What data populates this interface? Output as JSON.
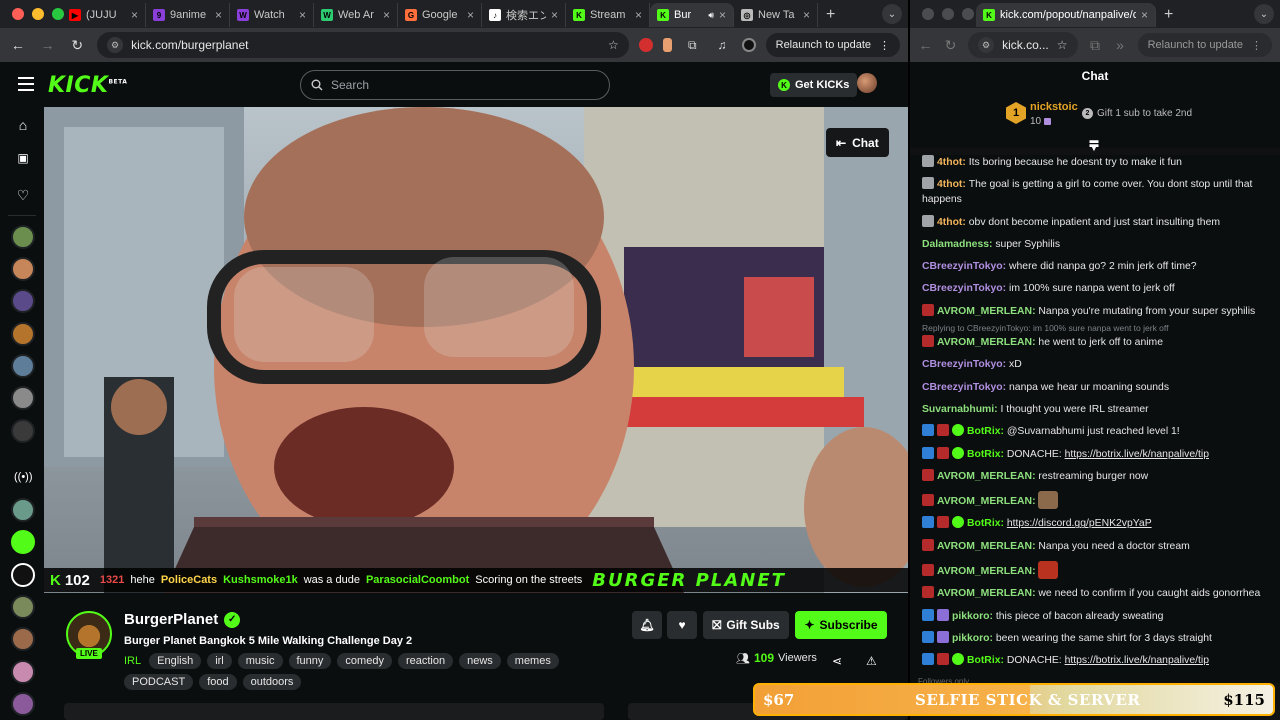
{
  "left_window": {
    "tabs": [
      {
        "title": "(JUJU",
        "fav_color": "#ff0000",
        "fav": "▶"
      },
      {
        "title": "9anime",
        "fav_color": "#8b3fd9",
        "fav": "9"
      },
      {
        "title": "Watch",
        "fav_color": "#8b3fd9",
        "fav": "W"
      },
      {
        "title": "Web Ar",
        "fav_color": "#2ecc71",
        "fav": "W"
      },
      {
        "title": "Google",
        "fav_color": "#ff6f3c",
        "fav": "G"
      },
      {
        "title": "検索エン",
        "fav_color": "#ffffff",
        "fav": "♪"
      },
      {
        "title": "Stream",
        "fav_color": "#53fc18",
        "fav": "K"
      },
      {
        "title": "Bur",
        "fav_color": "#53fc18",
        "fav": "K",
        "active": true
      },
      {
        "title": "New Ta",
        "fav_color": "#bbbbbb",
        "fav": "◎"
      }
    ],
    "url": "kick.com/burgerplanet",
    "relaunch": "Relaunch to update"
  },
  "right_window": {
    "url": "kick.com/popout/nanpalive/ch",
    "url_short": "kick.co...",
    "relaunch": "Relaunch to update"
  },
  "kick": {
    "search_placeholder": "Search",
    "get_kicks": "Get KICKs",
    "chat_button": "Chat",
    "ticker": {
      "count": "102",
      "items": [
        {
          "text": "1321",
          "cls": "red"
        },
        {
          "text": "hehe",
          "cls": ""
        },
        {
          "text": "PoliceCats",
          "cls": "yel"
        },
        {
          "text": "Kushsmoke1k",
          "cls": "grn"
        },
        {
          "text": "was a dude",
          "cls": ""
        },
        {
          "text": "ParasocialCoombot",
          "cls": "grn"
        },
        {
          "text": "Scoring on the streets",
          "cls": ""
        }
      ],
      "banner": "BURGER PLANET"
    },
    "streamer": {
      "name": "BurgerPlanet",
      "live": "LIVE",
      "title": "Burger Planet Bangkok 5 Mile Walking Challenge Day 2",
      "category": "IRL",
      "tags": [
        "English",
        "irl",
        "music",
        "funny",
        "comedy",
        "reaction",
        "news",
        "memes",
        "PODCAST",
        "food",
        "outdoors"
      ],
      "viewers_count": "109",
      "viewers_label": "Viewers",
      "gift_subs": "Gift Subs",
      "subscribe": "Subscribe"
    }
  },
  "chat": {
    "header": "Chat",
    "pinned": {
      "rank": "1",
      "name": "nickstoic",
      "count": "10",
      "gift_text": "Gift 1 sub to take 2nd"
    },
    "messages": [
      {
        "user": "4thot",
        "color": "#f0b35b",
        "badges": [
          "av"
        ],
        "text": "Its boring because he doesnt try to make it fun"
      },
      {
        "user": "4thot",
        "color": "#f0b35b",
        "badges": [
          "av"
        ],
        "text": "The goal is getting a girl to come over. You dont stop until that happens"
      },
      {
        "user": "4thot",
        "color": "#f0b35b",
        "badges": [
          "av"
        ],
        "text": "obv dont become inpatient and just start insulting them"
      },
      {
        "user": "Dalamadness",
        "color": "#8de07d",
        "badges": [],
        "text": "super Syphilis"
      },
      {
        "user": "CBreezyinTokyo",
        "color": "#b08fe0",
        "badges": [],
        "text": "where did nanpa go? 2 min jerk off time?"
      },
      {
        "user": "CBreezyinTokyo",
        "color": "#b08fe0",
        "badges": [],
        "text": "im 100% sure nanpa went to jerk off"
      },
      {
        "user": "AVROM_MERLEAN",
        "color": "#8de07d",
        "badges": [
          "red"
        ],
        "text": "Nanpa you're mutating from your super syphilis"
      },
      {
        "reply": "Replying to CBreezyinTokyo: im 100% sure nanpa went to jerk off",
        "user": "AVROM_MERLEAN",
        "color": "#8de07d",
        "badges": [
          "red"
        ],
        "text": "he went to jerk off to anime"
      },
      {
        "user": "CBreezyinTokyo",
        "color": "#b08fe0",
        "badges": [],
        "text": "xD"
      },
      {
        "user": "CBreezyinTokyo",
        "color": "#b08fe0",
        "badges": [],
        "text": "nanpa we hear ur moaning sounds"
      },
      {
        "user": "Suvarnabhumi",
        "color": "#8de07d",
        "badges": [],
        "text": "I thought you were IRL streamer"
      },
      {
        "user": "BotRix",
        "color": "#53fc18",
        "badges": [
          "blu",
          "red",
          "grn"
        ],
        "text": "@Suvarnabhumi just reached level 1!"
      },
      {
        "user": "BotRix",
        "color": "#53fc18",
        "badges": [
          "blu",
          "red",
          "grn"
        ],
        "text": "DONACHE: ",
        "link": "https://botrix.live/k/nanpalive/tip"
      },
      {
        "user": "AVROM_MERLEAN",
        "color": "#8de07d",
        "badges": [
          "red"
        ],
        "text": "restreaming burger now"
      },
      {
        "user": "AVROM_MERLEAN",
        "color": "#8de07d",
        "badges": [
          "red"
        ],
        "emote": "#8a6a4a"
      },
      {
        "user": "BotRix",
        "color": "#53fc18",
        "badges": [
          "blu",
          "red",
          "grn"
        ],
        "text": "",
        "link": "https://discord.gg/pENK2vpYaP"
      },
      {
        "user": "AVROM_MERLEAN",
        "color": "#8de07d",
        "badges": [
          "red"
        ],
        "text": "Nanpa you need a doctor stream"
      },
      {
        "user": "AVROM_MERLEAN",
        "color": "#8de07d",
        "badges": [
          "red"
        ],
        "emote": "#b8321f"
      },
      {
        "user": "AVROM_MERLEAN",
        "color": "#8de07d",
        "badges": [
          "red"
        ],
        "text": "we need to confirm if you caught aids gonorrhea"
      },
      {
        "user": "pikkoro",
        "color": "#8de07d",
        "badges": [
          "blu",
          "pur"
        ],
        "text": "this piece of bacon already sweating"
      },
      {
        "user": "pikkoro",
        "color": "#8de07d",
        "badges": [
          "blu",
          "pur"
        ],
        "text": "been wearing the same shirt for 3 days straight"
      },
      {
        "user": "BotRix",
        "color": "#53fc18",
        "badges": [
          "blu",
          "red",
          "grn"
        ],
        "text": "DONACHE: ",
        "link": "https://botrix.live/k/nanpalive/tip"
      }
    ],
    "followers_only": "Followers only"
  },
  "goal_bar": {
    "start": "$67",
    "title": "SELFIE STICK & SERVER",
    "end": "$115",
    "progress": 0.53
  }
}
